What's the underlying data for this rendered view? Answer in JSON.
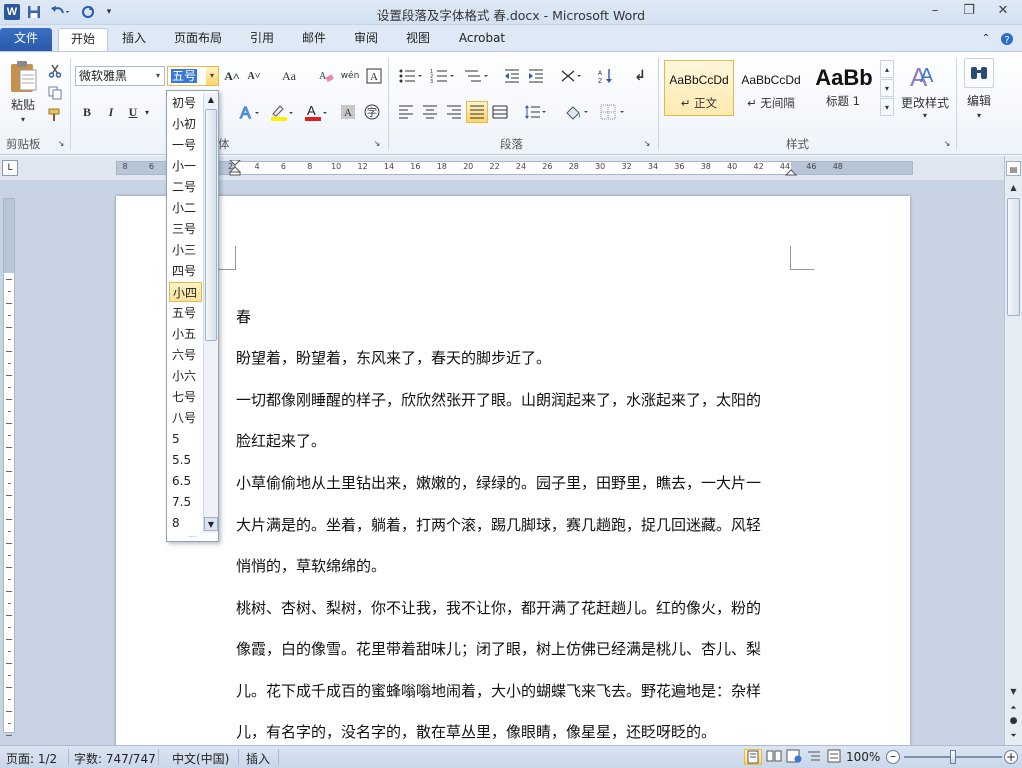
{
  "title": "设置段落及字体格式 春.docx - Microsoft Word",
  "window": {
    "minimize": "–",
    "restore": "❐",
    "close": "✕"
  },
  "quick_access": {
    "logo": "W",
    "save_icon": "save-icon",
    "undo_icon": "undo-icon",
    "redo_icon": "redo-icon"
  },
  "tabs": [
    {
      "label": "文件",
      "style": "file"
    },
    {
      "label": "开始",
      "style": "active"
    },
    {
      "label": "插入",
      "style": ""
    },
    {
      "label": "页面布局",
      "style": ""
    },
    {
      "label": "引用",
      "style": ""
    },
    {
      "label": "邮件",
      "style": ""
    },
    {
      "label": "审阅",
      "style": ""
    },
    {
      "label": "视图",
      "style": ""
    },
    {
      "label": "Acrobat",
      "style": ""
    }
  ],
  "ribbon": {
    "clipboard": {
      "paste_label": "粘贴",
      "group_label": "剪贴板"
    },
    "font": {
      "name": "微软雅黑",
      "size": "五号",
      "group_label": "体",
      "grow": "A˄",
      "shrink": "A˅",
      "case": "Aa",
      "wen": "wén",
      "bold": "B",
      "italic": "I",
      "underline": "U"
    },
    "paragraph": {
      "group_label": "段落"
    },
    "styles": {
      "group_label": "样式",
      "items": [
        {
          "sample": "AaBbCcDd",
          "name": "↵ 正文"
        },
        {
          "sample": "AaBbCcDd",
          "name": "↵ 无间隔"
        },
        {
          "sample": "AaBb",
          "name": "标题 1"
        }
      ],
      "change_label": "更改样式"
    },
    "edit_label": "编辑"
  },
  "ruler_numbers": [
    "8",
    "6",
    "4",
    "2",
    "2",
    "4",
    "6",
    "8",
    "10",
    "12",
    "14",
    "16",
    "18",
    "20",
    "22",
    "24",
    "26",
    "28",
    "30",
    "32",
    "34",
    "36",
    "38",
    "40",
    "42",
    "44",
    "46",
    "48"
  ],
  "document": {
    "lines": [
      "春",
      "盼望着，盼望着，东风来了，春天的脚步近了。",
      "一切都像刚睡醒的样子，欣欣然张开了眼。山朗润起来了，水涨起来了，太阳的",
      "脸红起来了。",
      "小草偷偷地从土里钻出来，嫩嫩的，绿绿的。园子里，田野里，瞧去，一大片一",
      "大片满是的。坐着，躺着，打两个滚，踢几脚球，赛几趟跑，捉几回迷藏。风轻",
      "悄悄的，草软绵绵的。",
      "桃树、杏树、梨树，你不让我，我不让你，都开满了花赶趟儿。红的像火，粉的",
      "像霞，白的像雪。花里带着甜味儿；闭了眼，树上仿佛已经满是桃儿、杏儿、梨",
      "儿。花下成千成百的蜜蜂嗡嗡地闹着，大小的蝴蝶飞来飞去。野花遍地是：杂样",
      "儿，有名字的，没名字的，散在草丛里，像眼睛，像星星，还眨呀眨的。"
    ]
  },
  "font_size_dropdown": {
    "selected": "小四",
    "options": [
      "初号",
      "小初",
      "一号",
      "小一",
      "二号",
      "小二",
      "三号",
      "小三",
      "四号",
      "小四",
      "五号",
      "小五",
      "六号",
      "小六",
      "七号",
      "八号",
      "5",
      "5.5",
      "6.5",
      "7.5",
      "8"
    ]
  },
  "status": {
    "page": "页面: 1/2",
    "words": "字数: 747/747",
    "language": "中文(中国)",
    "mode": "插入",
    "zoom": "100%"
  }
}
